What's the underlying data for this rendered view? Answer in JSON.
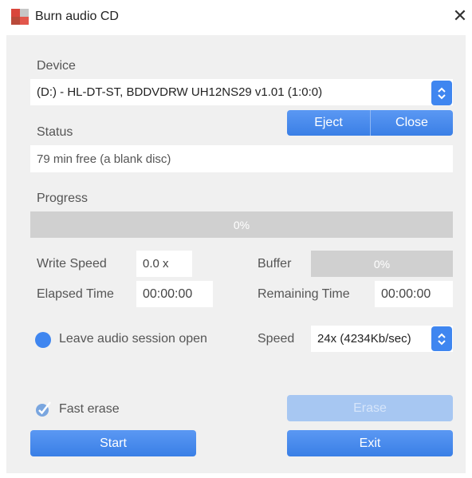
{
  "window": {
    "title": "Burn audio CD",
    "close_icon": "close-icon"
  },
  "device": {
    "label": "Device",
    "selected": "(D:) - HL-DT-ST, BDDVDRW UH12NS29 v1.01 (1:0:0)",
    "eject_label": "Eject",
    "close_label": "Close"
  },
  "status": {
    "label": "Status",
    "value": "79 min free (a blank disc)"
  },
  "progress": {
    "label": "Progress",
    "percent_text": "0%",
    "value": 0
  },
  "write_speed": {
    "label": "Write Speed",
    "value": "0.0 x"
  },
  "buffer": {
    "label": "Buffer",
    "percent_text": "0%",
    "value": 0
  },
  "elapsed": {
    "label": "Elapsed Time",
    "value": "00:00:00"
  },
  "remaining": {
    "label": "Remaining Time",
    "value": "00:00:00"
  },
  "leave_session": {
    "label": "Leave audio session open",
    "checked": true
  },
  "speed": {
    "label": "Speed",
    "selected": "24x (4234Kb/sec)"
  },
  "fast_erase": {
    "label": "Fast erase",
    "checked": true
  },
  "actions": {
    "erase_label": "Erase",
    "start_label": "Start",
    "exit_label": "Exit"
  },
  "colors": {
    "accent": "#3f86f0",
    "panel": "#f0f0f0",
    "bar_bg": "#d0d0d0",
    "disabled": "#a7c7f2"
  }
}
